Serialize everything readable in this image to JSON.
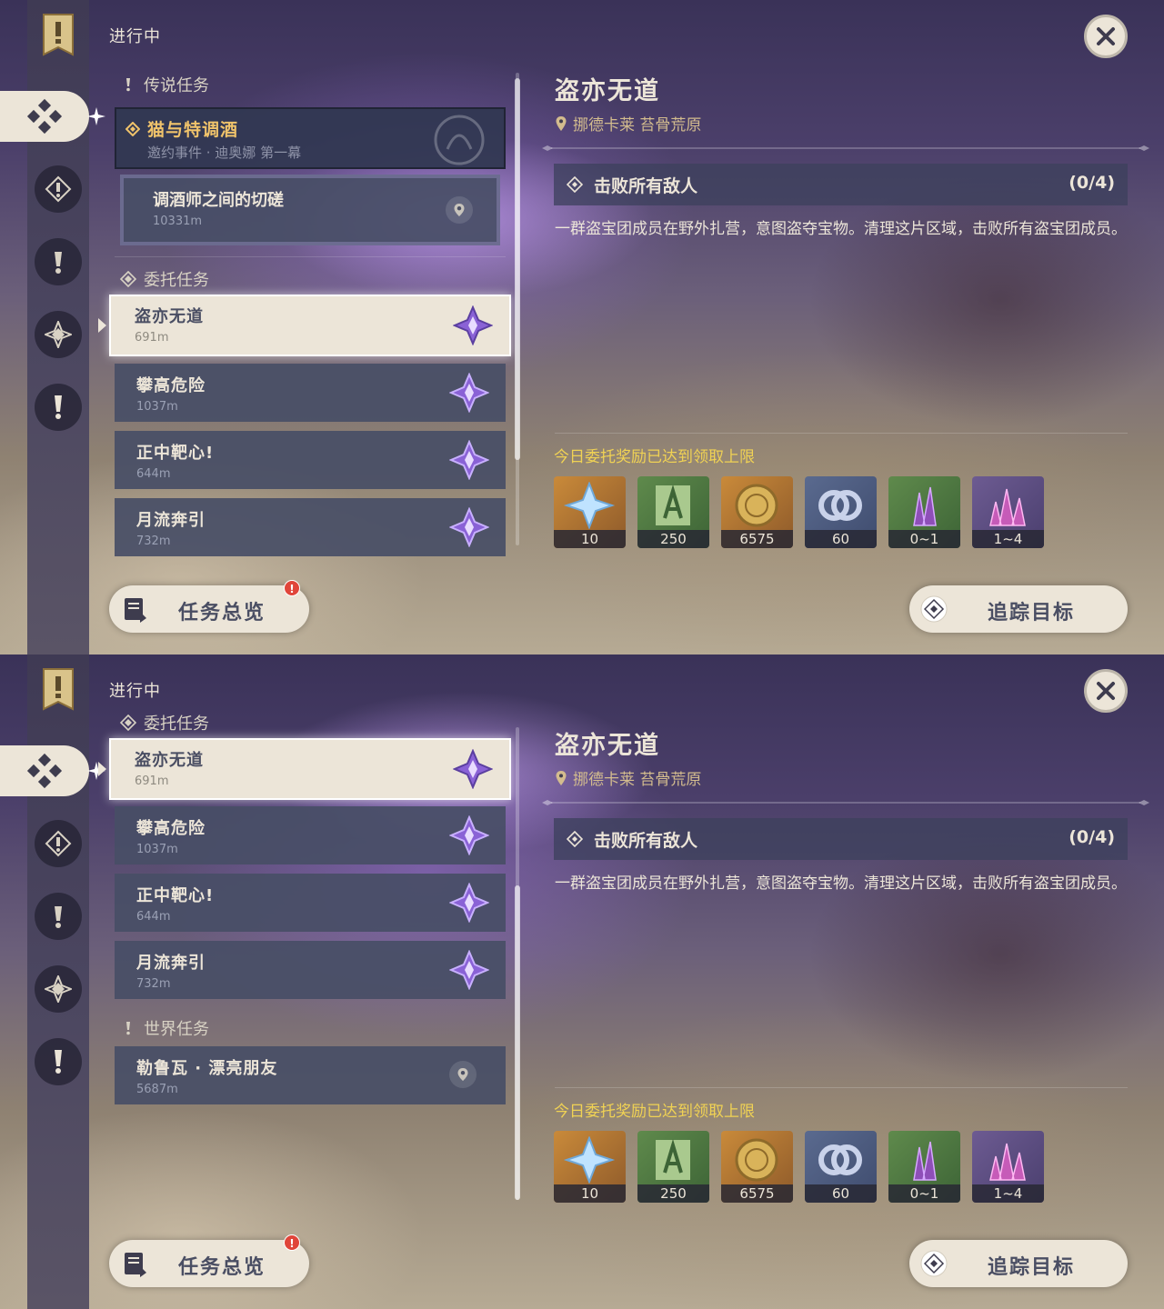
{
  "status_title": "进行中",
  "sections": {
    "legend": "传说任务",
    "commission": "委托任务",
    "world": "世界任务"
  },
  "legend_quest": {
    "name": "猫与特调酒",
    "sub": "邀约事件 · 迪奥娜 第一幕"
  },
  "legend_subquest": {
    "name": "调酒师之间的切磋",
    "dist": "10331m"
  },
  "commissions": [
    {
      "name": "盗亦无道",
      "dist": "691m"
    },
    {
      "name": "攀高危险",
      "dist": "1037m"
    },
    {
      "name": "正中靶心!",
      "dist": "644m"
    },
    {
      "name": "月流奔引",
      "dist": "732m"
    }
  ],
  "world_quest": {
    "name": "勒鲁瓦 · 漂亮朋友",
    "dist": "5687m"
  },
  "overview_button": {
    "label": "任务总览",
    "badge": "!"
  },
  "detail": {
    "title": "盗亦无道",
    "location": "挪德卡莱 苔骨荒原",
    "objective": "击败所有敌人",
    "progress": "(0/4)",
    "description": "一群盗宝团成员在野外扎营，意图盗夺宝物。清理这片区域，击败所有盗宝团成员。",
    "reward_note": "今日委托奖励已达到领取上限",
    "rewards": [
      {
        "icon": "primogem-icon",
        "qty": "10"
      },
      {
        "icon": "adventure-exp-icon",
        "qty": "250"
      },
      {
        "icon": "mora-icon",
        "qty": "6575"
      },
      {
        "icon": "companionship-exp-icon",
        "qty": "60"
      },
      {
        "icon": "crystal-icon",
        "qty": "0~1"
      },
      {
        "icon": "crystal-cluster-icon",
        "qty": "1~4"
      }
    ],
    "track_label": "追踪目标"
  },
  "colors": {
    "panel_light": "#ece5d8",
    "legend_gold": "#f0c36b",
    "reward_note_yellow": "#f0d254",
    "badge_red": "#e0453a"
  }
}
